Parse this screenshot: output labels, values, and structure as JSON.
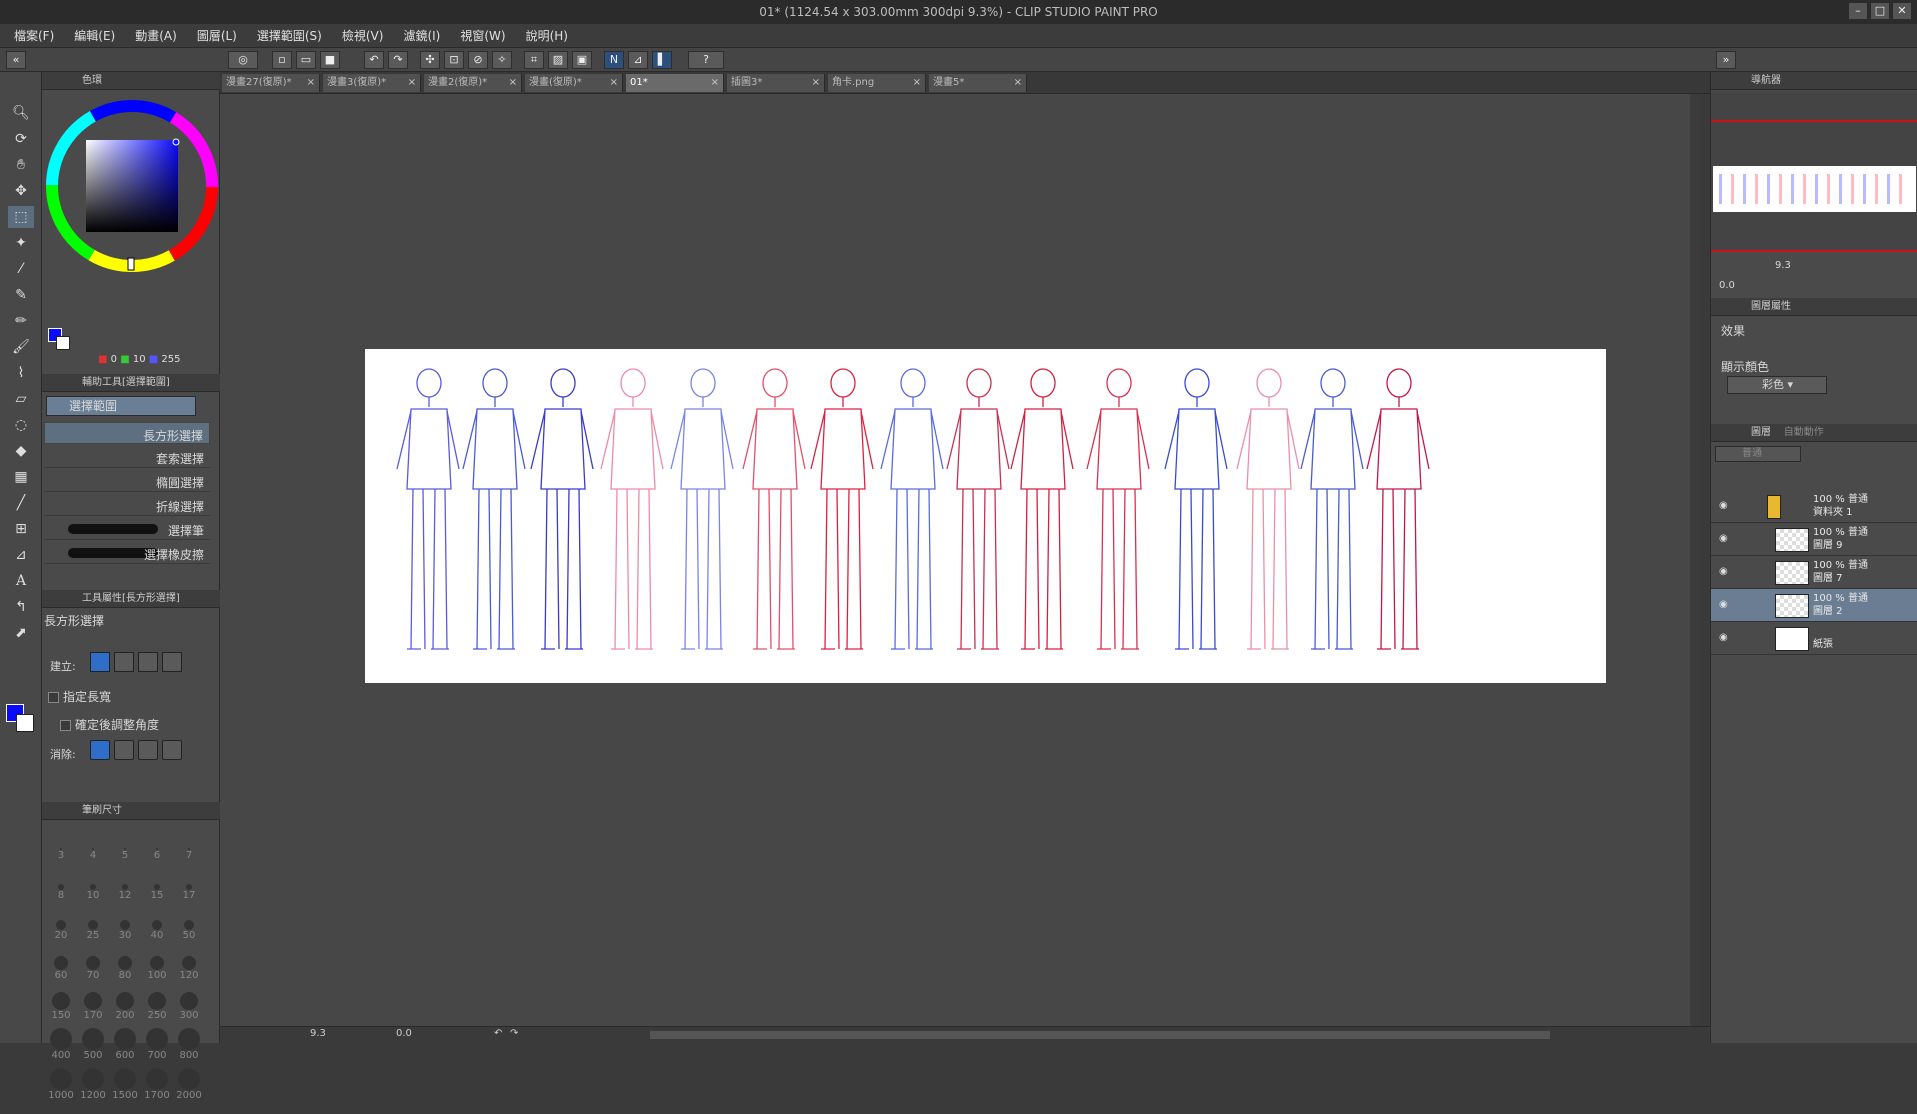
{
  "window": {
    "title": "01* (1124.54 x 303.00mm 300dpi 9.3%) - CLIP STUDIO PAINT PRO"
  },
  "menu": [
    "檔案(F)",
    "編輯(E)",
    "動畫(A)",
    "圖層(L)",
    "選擇範圍(S)",
    "檢視(V)",
    "濾鏡(I)",
    "視窗(W)",
    "說明(H)"
  ],
  "tabs": [
    {
      "label": "漫畫27(復原)*"
    },
    {
      "label": "漫畫3(復原)*"
    },
    {
      "label": "漫畫2(復原)*"
    },
    {
      "label": "漫畫(復原)*"
    },
    {
      "label": "01*",
      "active": true
    },
    {
      "label": "插圖3*"
    },
    {
      "label": "角卡.png"
    },
    {
      "label": "漫畫5*"
    }
  ],
  "color_panel": {
    "title": "色環",
    "rgb": {
      "r": "0",
      "g": "10",
      "b": "255"
    },
    "main_color": "#0a0aff"
  },
  "subtool_panel": {
    "title": "輔助工具[選擇範圍]",
    "group": "選擇範圍",
    "items": [
      "長方形選擇",
      "套索選擇",
      "橢圓選擇",
      "折線選擇",
      "選擇筆",
      "選擇橡皮擦"
    ]
  },
  "tool_property": {
    "title": "工具屬性[長方形選擇]",
    "tool_name": "長方形選擇",
    "mode_label": "建立:",
    "fixed_ratio_label": "指定長寬",
    "adjust_angle_label": "確定後調整角度",
    "antialias_label": "消除:"
  },
  "brush_size": {
    "title": "筆刷尺寸",
    "sizes": [
      "3",
      "4",
      "5",
      "6",
      "7",
      "8",
      "10",
      "12",
      "15",
      "17",
      "20",
      "25",
      "30",
      "40",
      "50",
      "60",
      "70",
      "80",
      "100",
      "120",
      "150",
      "170",
      "200",
      "250",
      "300",
      "400",
      "500",
      "600",
      "700",
      "800",
      "1000",
      "1200",
      "1500",
      "1700",
      "2000"
    ]
  },
  "navigator": {
    "title": "導航器",
    "zoom": "9.3",
    "rotate": "0.0"
  },
  "layer_property": {
    "title": "圖層屬性",
    "effect_label": "效果",
    "display_color_label": "顯示顏色",
    "display_color_value": "彩色"
  },
  "layer_panel": {
    "title": "圖層",
    "second_tab": "自動動作",
    "blend_mode": "普通",
    "layers": [
      {
        "line1": "100 % 普通",
        "line2": "資料夾 1",
        "type": "folder"
      },
      {
        "line1": "100 % 普通",
        "line2": "圖層 9",
        "type": "raster"
      },
      {
        "line1": "100 % 普通",
        "line2": "圖層 7",
        "type": "raster"
      },
      {
        "line1": "100 % 普通",
        "line2": "圖層 2",
        "type": "raster",
        "selected": true
      },
      {
        "line1": "",
        "line2": "紙張",
        "type": "paper"
      }
    ]
  },
  "status": {
    "zoom": "9.3",
    "angle": "0.0"
  }
}
